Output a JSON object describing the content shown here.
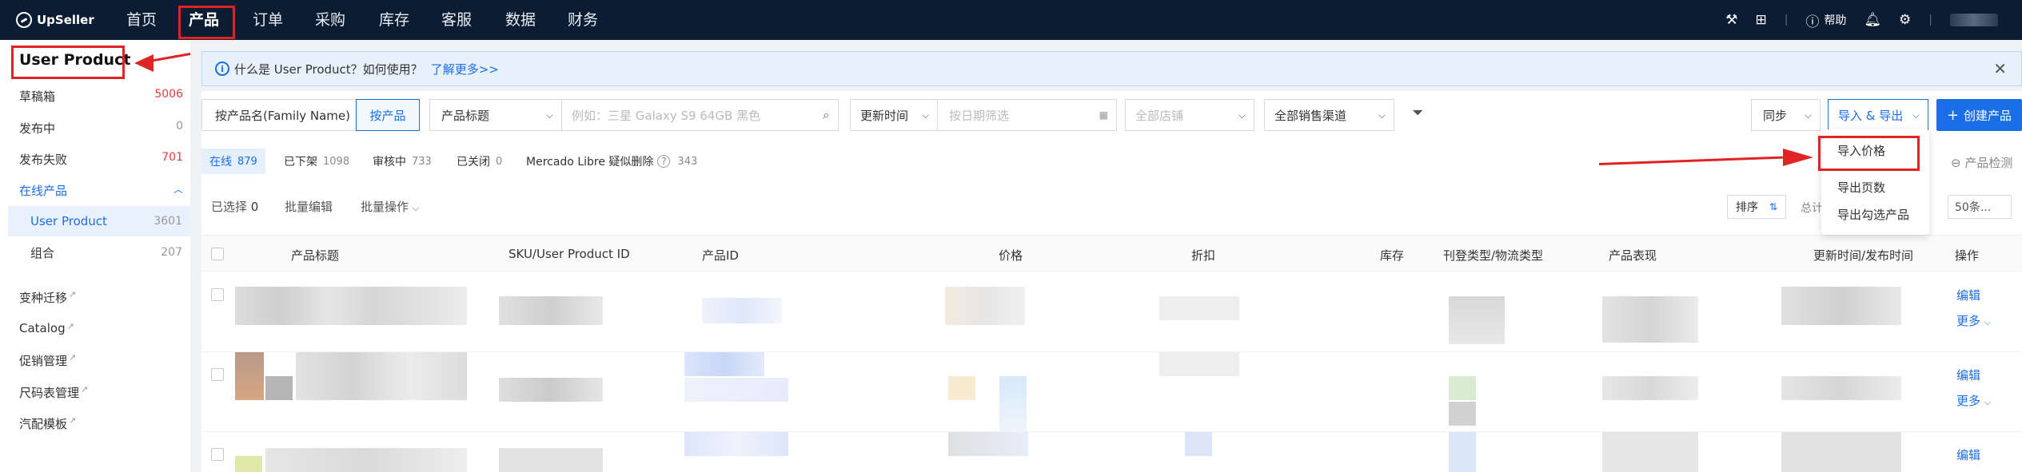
{
  "nav": {
    "brand": "UpSeller",
    "items": [
      "首页",
      "产品",
      "订单",
      "采购",
      "库存",
      "客服",
      "数据",
      "财务"
    ],
    "help": "帮助"
  },
  "sidebar": {
    "title": "User Product",
    "items": [
      {
        "label": "草稿箱",
        "count": "5006",
        "count_color": "red"
      },
      {
        "label": "发布中",
        "count": "0",
        "count_color": "gray"
      },
      {
        "label": "发布失败",
        "count": "701",
        "count_color": "red"
      }
    ],
    "online_group": "在线产品",
    "online_sub": [
      {
        "label": "User Product",
        "count": "3601",
        "active": true
      },
      {
        "label": "组合",
        "count": "207",
        "active": false
      }
    ],
    "links": [
      "变种迁移",
      "Catalog",
      "促销管理",
      "尺码表管理",
      "汽配模板"
    ]
  },
  "info_banner": {
    "text": "什么是 User Product？如何使用？",
    "link": "了解更多>>"
  },
  "filters": {
    "product_name_mode": "按产品名(Family Name)",
    "product_mode": "按产品",
    "title_select": "产品标题",
    "title_placeholder": "例如：三星 Galaxy S9 64GB 黑色",
    "time_select": "更新时间",
    "date_placeholder": "按日期筛选",
    "store_placeholder": "全部店铺",
    "channel_select": "全部销售渠道"
  },
  "actions": {
    "sync": "同步",
    "import_export": "导入 & 导出",
    "create": "创建产品",
    "check": "产品检测"
  },
  "status_tabs": [
    {
      "label": "在线",
      "count": "879",
      "active": true
    },
    {
      "label": "已下架",
      "count": "1098"
    },
    {
      "label": "审核中",
      "count": "733"
    },
    {
      "label": "已关闭",
      "count": "0"
    },
    {
      "label": "Mercado Libre 疑似删除",
      "count": "343"
    }
  ],
  "toolbar": {
    "selected_label": "已选择",
    "selected_count": "0",
    "bulk_edit": "批量编辑",
    "bulk_action": "批量操作",
    "sort": "排序",
    "total": "总计",
    "page_size": "50条..."
  },
  "table": {
    "columns": [
      "产品标题",
      "SKU/User Product ID",
      "产品ID",
      "价格",
      "折扣",
      "库存",
      "刊登类型/物流类型",
      "产品表现",
      "更新时间/发布时间",
      "操作"
    ],
    "row_actions": {
      "edit": "编辑",
      "more": "更多"
    }
  },
  "dropdown_menu": {
    "items": [
      "导入价格",
      "导出页数",
      "导出勾选产品"
    ]
  }
}
